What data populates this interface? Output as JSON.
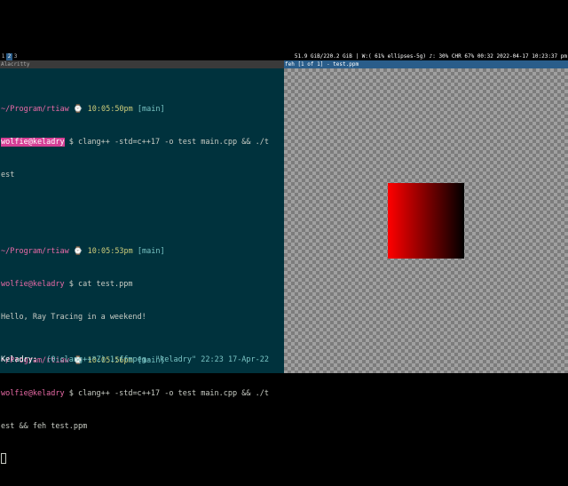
{
  "top_bar": {
    "workspaces": [
      {
        "label": "1",
        "active": false
      },
      {
        "label": "2",
        "active": true
      },
      {
        "label": "3",
        "active": false
      }
    ],
    "disk": "51.9 GiB/220.2 GiB",
    "wifi": "W:( 61% ellipses-5g)",
    "volume": "♪: 30%",
    "battery": "CHR 67% 00:32",
    "datetime": "2022-04-17 10:23:37 pm"
  },
  "terminal": {
    "title": "Alacritty",
    "dir": "~/Program/rtiaw",
    "clock_glyph": "⌚",
    "user": "wolfie@keladry",
    "prompt_sym": "$",
    "entries": [
      {
        "time": "10:05:50pm",
        "branch": "[main]",
        "cmd1": "clang++ -std=c++17 -o test main.cpp && ./t",
        "cmd2": "est",
        "output": ""
      },
      {
        "time": "10:05:53pm",
        "branch": "[main]",
        "cmd1": "cat test.ppm",
        "cmd2": "",
        "output": "Hello, Ray Tracing in a weekend!"
      },
      {
        "time": "10:05:56pm",
        "branch": "[main]",
        "cmd1": "clang++ -std=c++17 -o test main.cpp && ./t",
        "cmd2": "est && feh test.ppm",
        "output": ""
      }
    ],
    "tmux": {
      "session": "Keladry:",
      "win0": "(0:clang++*Z)",
      "win1": "1:ffmpeg-",
      "host": "\"keladry\"",
      "time": "22:23",
      "date": "17-Apr-22"
    }
  },
  "feh": {
    "title": "feh [1 of 1] - test.ppm",
    "colors": {
      "start": "#ff0000",
      "end": "#000000"
    }
  }
}
